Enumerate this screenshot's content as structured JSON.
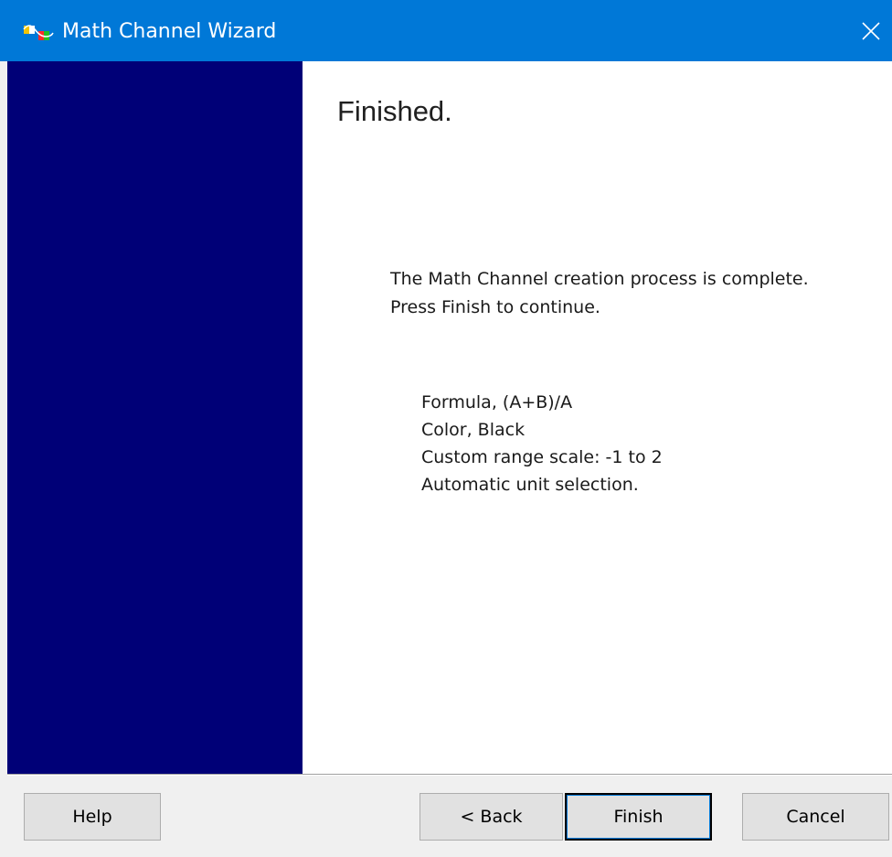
{
  "window": {
    "title": "Math Channel Wizard",
    "close_icon": "close-icon",
    "app_icon": "math-channel-app-icon"
  },
  "main": {
    "heading": "Finished.",
    "message_lines": [
      "The Math Channel creation process is complete.",
      "Press Finish to continue."
    ],
    "summary_lines": [
      "Formula, (A+B)/A",
      "Color, Black",
      "Custom range scale: -1 to 2",
      "Automatic unit selection."
    ]
  },
  "buttons": {
    "help": "Help",
    "back": "< Back",
    "finish": "Finish",
    "cancel": "Cancel"
  },
  "colors": {
    "titlebar": "#0078d7",
    "side_panel": "#000077",
    "window_bg": "#f0f0f0",
    "content_bg": "#ffffff"
  }
}
